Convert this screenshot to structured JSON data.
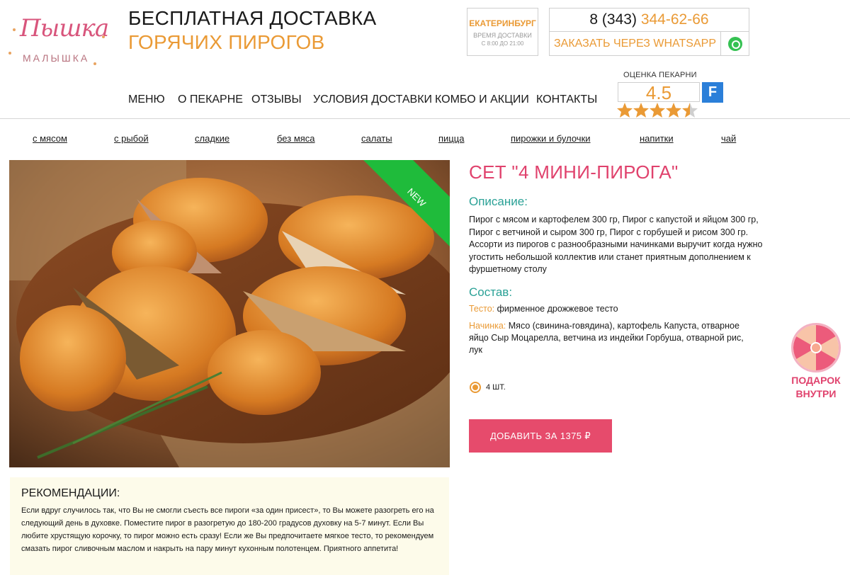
{
  "logo": {
    "script": "Пышка",
    "sub": "МАЛЫШКА"
  },
  "promo": {
    "line1": "БЕСПЛАТНАЯ ДОСТАВКА",
    "line2": "ГОРЯЧИХ ПИРОГОВ"
  },
  "city": {
    "name": "ЕКАТЕРИНБУРГ",
    "time_label": "ВРЕМЯ ДОСТАВКИ",
    "time_value": "С 8:00 ДО 21:00"
  },
  "contact": {
    "phone_code": "8 (343)",
    "phone_number": "344-62-66",
    "whatsapp_label": "ЗАКАЗАТЬ ЧЕРЕЗ WHATSAPP",
    "whatsapp_icon": "whatsapp-icon"
  },
  "nav": [
    "МЕНЮ",
    "О ПЕКАРНЕ",
    "ОТЗЫВЫ",
    "УСЛОВИЯ ДОСТАВКИ",
    "КОМБО И АКЦИИ",
    "КОНТАКТЫ"
  ],
  "rating": {
    "label": "ОЦЕНКА ПЕКАРНИ",
    "value": "4.5",
    "stars": 4.5,
    "max_stars": 5,
    "service_logo": "F"
  },
  "categories": [
    "с мясом",
    "с рыбой",
    "сладкие",
    "без мяса",
    "салаты",
    "пицца",
    "пирожки и булочки",
    "напитки",
    "чай"
  ],
  "product": {
    "badge": "NEW",
    "title": "СЕТ \"4 МИНИ-ПИРОГА\"",
    "desc_heading": "Описание:",
    "description": "Пирог с мясом и картофелем 300 гр, Пирог с капустой и яйцом 300 гр, Пирог с ветчиной и сыром 300 гр, Пирог с горбушей и рисом 300 гр. Ассорти из пирогов с разнообразными начинками выручит когда нужно угостить небольшой коллектив или станет приятным дополнением к фуршетному столу",
    "comp_heading": "Состав:",
    "dough_label": "Тесто:",
    "dough_value": "фирменное дрожжевое тесто",
    "filling_label": "Начинка:",
    "filling_value": "Мясо (свинина-говядина), картофель Капуста, отварное яйцо Сыр Моцарелла, ветчина из индейки Горбуша, отварной рис, лук",
    "quantity": "4 ШТ.",
    "add_button": "ДОБАВИТЬ ЗА 1375 ₽"
  },
  "recommendations": {
    "title": "РЕКОМЕНДАЦИИ:",
    "text": "Если вдруг случилось так, что Вы не смогли съесть все пироги «за один присест», то Вы можете разогреть его на следующий день в духовке. Поместите пирог в разогретую до 180-200 градусов духовку на 5-7 минут. Если Вы любите хрустящую корочку, то пирог можно есть сразу! Если же Вы предпочитаете мягкое тесто, то рекомендуем смазать пирог сливочным маслом и накрыть на пару минут кухонным полотенцем. Приятного аппетита!"
  },
  "gift": {
    "line1": "ПОДАРОК",
    "line2": "ВНУТРИ"
  },
  "colors": {
    "accent_orange": "#ea9a35",
    "accent_pink": "#e0426d",
    "accent_teal": "#2aa196",
    "button": "#e64b6c",
    "badge_green": "#1fbb3b",
    "reco_bg": "#fdfbea"
  }
}
